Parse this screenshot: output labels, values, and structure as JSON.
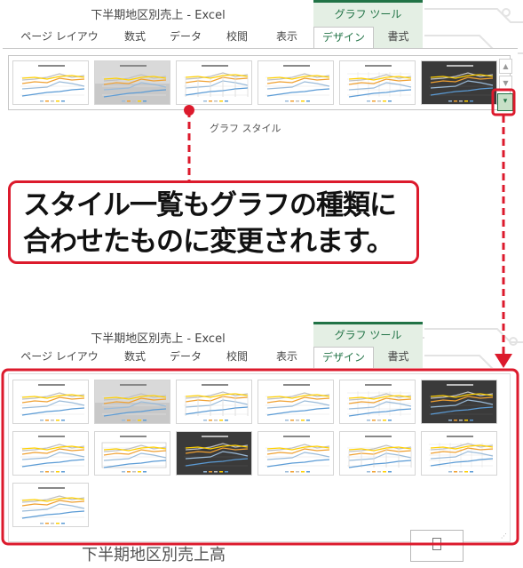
{
  "window": {
    "title": "下半期地区別売上 - Excel",
    "context_tab_group": "グラフ ツール"
  },
  "ribbon": {
    "tabs": [
      "ページ レイアウト",
      "数式",
      "データ",
      "校閲",
      "表示",
      "デザイン",
      "書式"
    ],
    "active_tab": "デザイン",
    "group_label": "グラフ スタイル",
    "more_button_icon": "dropdown-more-icon"
  },
  "callout": {
    "line1": "スタイル一覧もグラフの種類に",
    "line2": "合わせたものに変更されます。"
  },
  "background": {
    "chart_title": "下半期地区別売上高"
  },
  "colors": {
    "accent_red": "#dc1a2c",
    "excel_green": "#217346",
    "context_tab_bg": "#e4efe4",
    "dark_style_bg": "#3a3a3a"
  }
}
